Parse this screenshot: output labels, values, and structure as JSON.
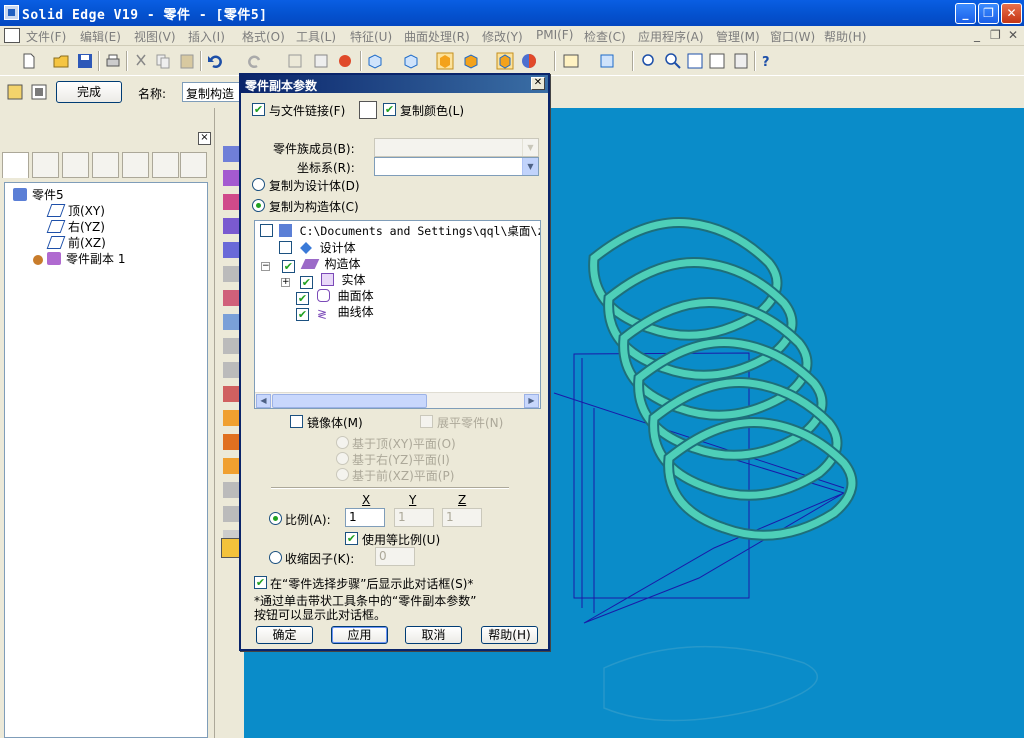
{
  "window": {
    "title": "Solid Edge V19 - 零件 - [零件5]"
  },
  "menu": [
    "文件(F)",
    "编辑(E)",
    "视图(V)",
    "插入(I)",
    "格式(O)",
    "工具(L)",
    "特征(U)",
    "曲面处理(R)",
    "修改(Y)",
    "PMI(F)",
    "检查(C)",
    "应用程序(A)",
    "管理(M)",
    "窗口(W)",
    "帮助(H)"
  ],
  "ribbon": {
    "finish_label": "完成",
    "name_label": "名称:",
    "name_value": "复制构造"
  },
  "tree": {
    "items": [
      {
        "label": "零件5",
        "icon": "part-icon"
      },
      {
        "label": "顶(XY)",
        "icon": "plane-icon"
      },
      {
        "label": "右(YZ)",
        "icon": "plane-icon"
      },
      {
        "label": "前(XZ)",
        "icon": "plane-icon"
      },
      {
        "label": "零件副本 1",
        "icon": "part-copy-icon"
      }
    ]
  },
  "dialog": {
    "title": "零件副本参数",
    "link_label": "与文件链接(F)",
    "copy_color_label": "复制颜色(L)",
    "family_label": "零件族成员(B):",
    "coord_label": "坐标系(R):",
    "as_design_label": "复制为设计体(D)",
    "as_construction_label": "复制为构造体(C)",
    "tree_root": "C:\\Documents and Settings\\qql\\桌面\\z",
    "tree_design": "设计体",
    "tree_construction": "构造体",
    "tree_solid": "实体",
    "tree_surface": "曲面体",
    "tree_curve": "曲线体",
    "mirror_label": "镜像体(M)",
    "flatten_label": "展平零件(N)",
    "base_top": "基于顶(XY)平面(O)",
    "base_right": "基于右(YZ)平面(I)",
    "base_front": "基于前(XZ)平面(P)",
    "x_header": "X",
    "y_header": "Y",
    "z_header": "Z",
    "scale_label": "比例(A):",
    "scale_x": "1",
    "scale_y": "1",
    "scale_z": "1",
    "uniform_label": "使用等比例(U)",
    "shrink_label": "收缩因子(K):",
    "shrink_value": "0",
    "show_dialog_label": "在“零件选择步骤”后显示此对话框(S)*",
    "note_line1": "*通过单击带状工具条中的“零件副本参数”",
    "note_line2": "按钮可以显示此对话框。",
    "ok_label": "确定",
    "apply_label": "应用",
    "cancel_label": "取消",
    "help_label": "帮助(H)"
  },
  "colors": {
    "viewport_bg": "#0a8cc9",
    "coil": "#4ecfb8",
    "construction_lines": "#1a1aa8",
    "titlebar": "#0a5ee3"
  }
}
